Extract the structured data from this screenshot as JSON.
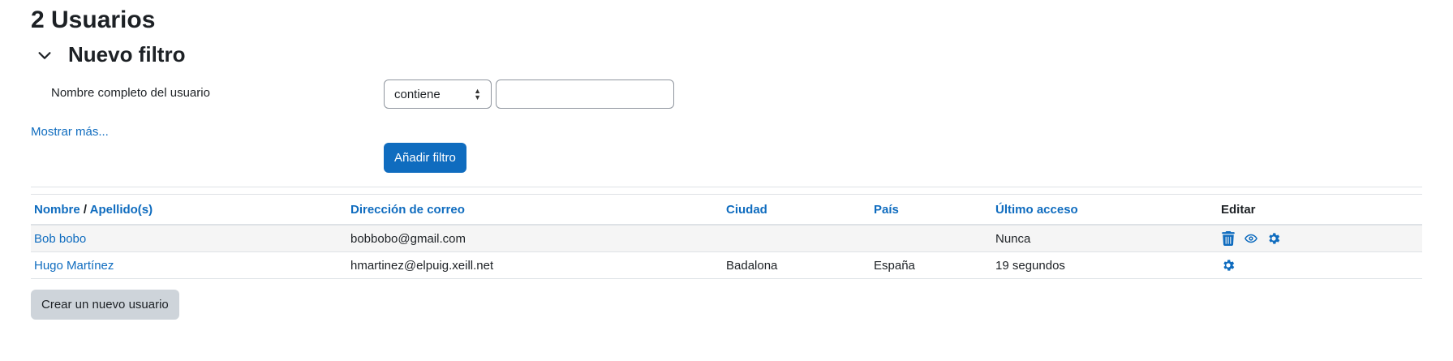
{
  "page_title": "2 Usuarios",
  "filter": {
    "section_title": "Nuevo filtro",
    "field_label": "Nombre completo del usuario",
    "operator_selected": "contiene",
    "value": "",
    "show_more": "Mostrar más...",
    "add_button": "Añadir filtro"
  },
  "table": {
    "headers": {
      "nombre": "Nombre",
      "slash": " / ",
      "apellidos": "Apellido(s)",
      "email": "Dirección de correo",
      "ciudad": "Ciudad",
      "pais": "País",
      "ultimo_acceso": "Último acceso",
      "editar": "Editar"
    },
    "rows": [
      {
        "name": "Bob bobo",
        "email": "bobbobo@gmail.com",
        "city": "",
        "country": "",
        "last_access": "Nunca",
        "actions": [
          "trash-icon",
          "eye-icon",
          "gear-icon"
        ]
      },
      {
        "name": "Hugo Martínez",
        "email": "hmartinez@elpuig.xeill.net",
        "city": "Badalona",
        "country": "España",
        "last_access": "19 segundos",
        "actions": [
          "gear-icon"
        ]
      }
    ]
  },
  "create_button": "Crear un nuevo usuario",
  "colors": {
    "accent": "#0f6cbf",
    "secondary_button": "#ced4da",
    "text": "#1d2125"
  }
}
